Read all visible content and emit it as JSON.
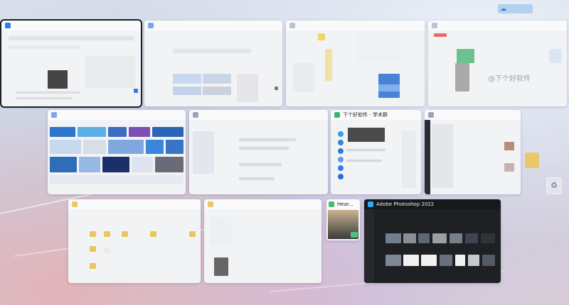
{
  "windows": [
    {
      "id": "edge",
      "title": "",
      "icon": "edge-icon",
      "active": true
    },
    {
      "id": "doc1",
      "title": "",
      "icon": "doc-icon"
    },
    {
      "id": "sheet",
      "title": "",
      "icon": "doc-icon"
    },
    {
      "id": "site",
      "title": "",
      "icon": "doc-icon",
      "watermark": "@下个好软件"
    },
    {
      "id": "gallery",
      "title": "",
      "icon": "doc-icon"
    },
    {
      "id": "editor",
      "title": "",
      "icon": "doc-icon"
    },
    {
      "id": "bilibili",
      "title": "下个好软件 - 学术群",
      "icon": "chat-icon"
    },
    {
      "id": "chat",
      "title": "",
      "icon": "doc-icon"
    },
    {
      "id": "explorer1",
      "title": "",
      "icon": "folder-icon"
    },
    {
      "id": "explorer2",
      "title": "",
      "icon": "folder-icon"
    },
    {
      "id": "music",
      "title": "Hear...",
      "icon": "music-icon"
    },
    {
      "id": "photoshop",
      "title": "Adobe Photoshop 2022",
      "icon": "photoshop-icon"
    }
  ],
  "colors": {
    "accent": "#2f7ee8",
    "ps_bg": "#1f2024",
    "active_outline": "#1b1f27"
  }
}
